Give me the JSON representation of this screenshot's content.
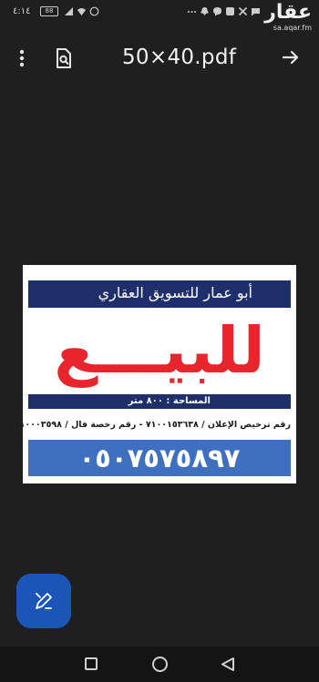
{
  "status_bar": {
    "time": "٤:١٤",
    "battery": "88",
    "watermark_logo": "عقار",
    "watermark_url": "sa.aqar.fm"
  },
  "toolbar": {
    "file_name": "50×40.pdf",
    "icons": [
      "more-vert-icon",
      "find-in-doc-icon",
      "open-arrow-icon"
    ]
  },
  "document": {
    "company_name": "أبو عمار للتسويق العقاري",
    "logo_text": "عمار",
    "headline": "للبيـــع",
    "area": "المساحة : ٨٠٠ متر",
    "license": "رقم ترخيص الإعلان / ٧١٠٠١٥٣٦٣٨  -  رقم رخصة فال / ١١٠٠٠٣٥٩٨",
    "phone": "٠٥٠٧٥٧٥٨٩٧",
    "colors": {
      "navy": "#1e2f6b",
      "red": "#e8242c",
      "blue": "#3f6fbf"
    }
  },
  "fab": {
    "icon": "edit-pen-icon",
    "color": "#1b55b8"
  },
  "nav": {
    "icons": [
      "recents-icon",
      "home-icon",
      "back-icon"
    ]
  }
}
